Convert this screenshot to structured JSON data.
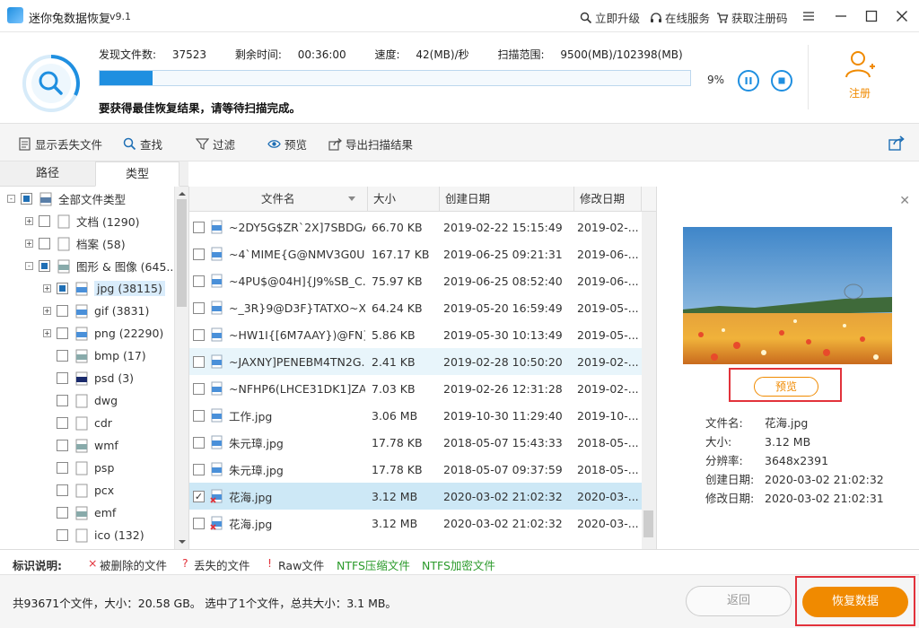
{
  "titlebar": {
    "app_title": "迷你兔数据恢复",
    "version": "v9.1",
    "upgrade": "立即升级",
    "online_service": "在线服务",
    "get_code": "获取注册码"
  },
  "scan": {
    "found_label": "发现文件数:",
    "found_value": "37523",
    "remaining_label": "剩余时间:",
    "remaining_value": "00:36:00",
    "speed_label": "速度:",
    "speed_value": "42(MB)/秒",
    "range_label": "扫描范围:",
    "range_value": "9500(MB)/102398(MB)",
    "progress_fraction": 0.09,
    "percent": "9%",
    "hint": "要获得最佳恢复结果，请等待扫描完成。",
    "register_label": "注册"
  },
  "toolbar": {
    "show_lost": "显示丢失文件",
    "find": "查找",
    "filter": "过滤",
    "preview": "预览",
    "export": "导出扫描结果"
  },
  "tabs": [
    "路径",
    "类型"
  ],
  "tree": [
    {
      "label": "全部文件类型",
      "icon": "computer-icon"
    },
    {
      "label": "文档 (1290)",
      "icon": "document-icon"
    },
    {
      "label": "档案 (58)",
      "icon": "archive-icon"
    },
    {
      "label": "图形 & 图像 (645...",
      "icon": "image-icon"
    },
    {
      "label": "jpg (38115)",
      "icon": "jpg-icon"
    },
    {
      "label": "gif (3831)",
      "icon": "gif-icon"
    },
    {
      "label": "png (22290)",
      "icon": "png-icon"
    },
    {
      "label": "bmp (17)",
      "icon": "bmp-icon"
    },
    {
      "label": "psd (3)",
      "icon": "psd-icon"
    },
    {
      "label": "dwg",
      "icon": "file-icon"
    },
    {
      "label": "cdr",
      "icon": "file-icon"
    },
    {
      "label": "wmf",
      "icon": "wmf-icon"
    },
    {
      "label": "psp",
      "icon": "file-icon"
    },
    {
      "label": "pcx",
      "icon": "file-icon"
    },
    {
      "label": "emf",
      "icon": "emf-icon"
    },
    {
      "label": "ico (132)",
      "icon": "file-icon"
    }
  ],
  "file_headers": [
    "文件名",
    "大小",
    "创建日期",
    "修改日期"
  ],
  "files": [
    {
      "name": "~2DY5G$ZR`2X]7SBDGA...",
      "size": "66.70 KB",
      "created": "2019-02-22 15:15:49",
      "modified": "2019-02-..."
    },
    {
      "name": "~4`MIME{G@NMV3G0UE...",
      "size": "167.17 KB",
      "created": "2019-06-25 09:21:31",
      "modified": "2019-06-..."
    },
    {
      "name": "~4PU$@04H]{J9%SB_C...",
      "size": "75.97 KB",
      "created": "2019-06-25 08:52:40",
      "modified": "2019-06-..."
    },
    {
      "name": "~_3R}9@D3F}TATXO~X~...",
      "size": "64.24 KB",
      "created": "2019-05-20 16:59:49",
      "modified": "2019-05-..."
    },
    {
      "name": "~HW1I{[6M7AAY})@FN]K...",
      "size": "5.86 KB",
      "created": "2019-05-30 10:13:49",
      "modified": "2019-05-..."
    },
    {
      "name": "~JAXNY]PENEBM4TN2G...",
      "size": "2.41 KB",
      "created": "2019-02-28 10:50:20",
      "modified": "2019-02-..."
    },
    {
      "name": "~NFHP6(LHCE31DK1]ZA...",
      "size": "7.03 KB",
      "created": "2019-02-26 12:31:28",
      "modified": "2019-02-..."
    },
    {
      "name": "工作.jpg",
      "size": "3.06 MB",
      "created": "2019-10-30 11:29:40",
      "modified": "2019-10-..."
    },
    {
      "name": "朱元璋.jpg",
      "size": "17.78 KB",
      "created": "2018-05-07 15:43:33",
      "modified": "2018-05-..."
    },
    {
      "name": "朱元璋.jpg",
      "size": "17.78 KB",
      "created": "2018-05-07 09:37:59",
      "modified": "2018-05-..."
    },
    {
      "name": "花海.jpg",
      "size": "3.12 MB",
      "created": "2020-03-02 21:02:32",
      "modified": "2020-03-..."
    },
    {
      "name": "花海.jpg",
      "size": "3.12 MB",
      "created": "2020-03-02 21:02:32",
      "modified": "2020-03-..."
    }
  ],
  "preview": {
    "button": "预览",
    "filename_label": "文件名:",
    "filename_value": "花海.jpg",
    "size_label": "大小:",
    "size_value": "3.12 MB",
    "resolution_label": "分辨率:",
    "resolution_value": "3648x2391",
    "created_label": "创建日期:",
    "created_value": "2020-03-02 21:02:32",
    "modified_label": "修改日期:",
    "modified_value": "2020-03-02 21:02:31"
  },
  "legend": {
    "title": "标识说明:",
    "deleted_mark": "×",
    "deleted": "被删除的文件",
    "lost_mark": "?",
    "lost": "丢失的文件",
    "raw_mark": "!",
    "raw": "Raw文件",
    "ntfs_compressed": "NTFS压缩文件",
    "ntfs_encrypted": "NTFS加密文件"
  },
  "footer": {
    "summary": "共93671个文件，大小：20.58 GB。 选中了1个文件，总共大小：3.1 MB。",
    "back": "返回",
    "recover": "恢复数据"
  },
  "colors": {
    "accent_blue": "#1f8fe0",
    "accent_orange": "#f08a00",
    "highlight_red": "#e2323b"
  }
}
